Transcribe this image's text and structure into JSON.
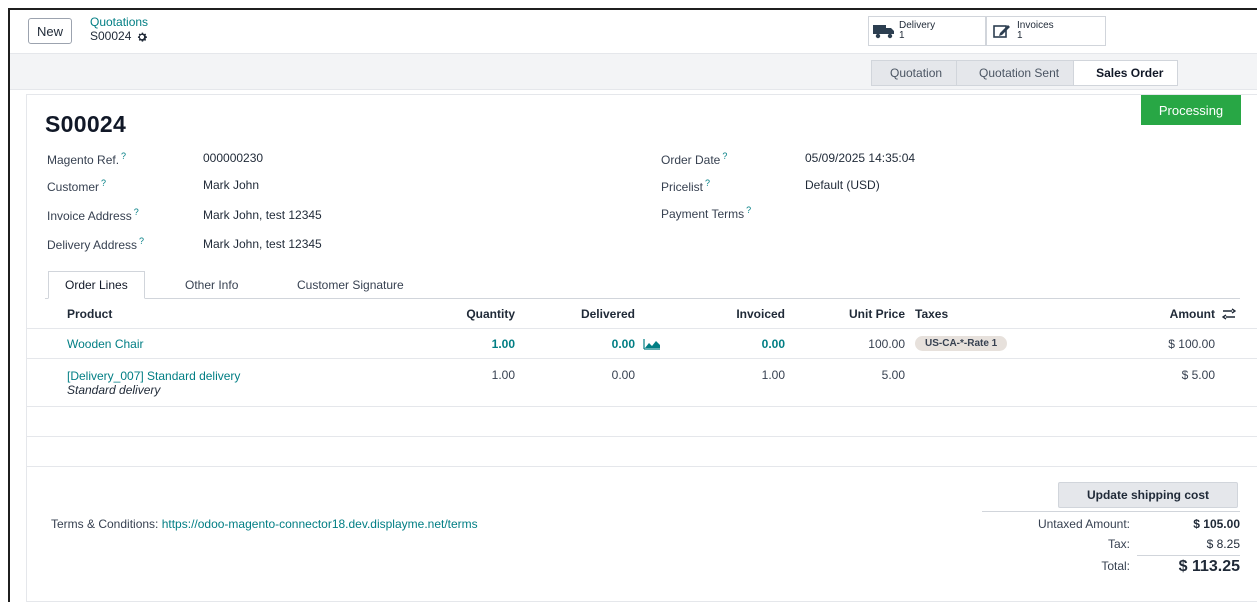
{
  "control_panel": {
    "new_label": "New",
    "breadcrumb_parent": "Quotations",
    "breadcrumb_current": "S00024",
    "smart_buttons": {
      "delivery": {
        "label": "Delivery",
        "count": "1",
        "icon": "truck-icon"
      },
      "invoices": {
        "label": "Invoices",
        "count": "1",
        "icon": "pencil-square-icon"
      }
    }
  },
  "statusbar": {
    "stages": [
      "Quotation",
      "Quotation Sent",
      "Sales Order"
    ],
    "active": "Sales Order"
  },
  "sheet": {
    "ribbon": "Processing",
    "ribbon_color": "#28a745",
    "title": "S00024",
    "fields_left": [
      {
        "label": "Magento Ref.",
        "value": "000000230"
      },
      {
        "label": "Customer",
        "value": "Mark John"
      },
      {
        "label": "Invoice Address",
        "value": "Mark John, test 12345"
      },
      {
        "label": "Delivery Address",
        "value": "Mark John, test 12345"
      }
    ],
    "fields_right": [
      {
        "label": "Order Date",
        "value": "05/09/2025 14:35:04"
      },
      {
        "label": "Pricelist",
        "value": "Default (USD)"
      },
      {
        "label": "Payment Terms",
        "value": ""
      }
    ],
    "help_marker": "?"
  },
  "tabs": [
    "Order Lines",
    "Other Info",
    "Customer Signature"
  ],
  "order_lines": {
    "headers": {
      "product": "Product",
      "quantity": "Quantity",
      "delivered": "Delivered",
      "invoiced": "Invoiced",
      "unit_price": "Unit Price",
      "taxes": "Taxes",
      "amount": "Amount"
    },
    "rows": [
      {
        "product": "Wooden Chair",
        "note": "",
        "quantity": "1.00",
        "delivered": "0.00",
        "invoiced": "0.00",
        "unit_price": "100.00",
        "tax": "US-CA-*-Rate 1",
        "amount": "$ 100.00"
      },
      {
        "product": "[Delivery_007] Standard delivery",
        "note": "Standard delivery",
        "quantity": "1.00",
        "delivered": "0.00",
        "invoiced": "1.00",
        "unit_price": "5.00",
        "tax": "",
        "amount": "$ 5.00"
      }
    ]
  },
  "footer": {
    "update_shipping_label": "Update shipping cost",
    "terms_label": "Terms & Conditions:",
    "terms_link": "https://odoo-magento-connector18.dev.displayme.net/terms",
    "totals": {
      "untaxed_label": "Untaxed Amount:",
      "untaxed_value": "$ 105.00",
      "tax_label": "Tax:",
      "tax_value": "$ 8.25",
      "total_label": "Total:",
      "total_value": "$ 113.25"
    }
  },
  "colors": {
    "accent": "#017e84",
    "status_green": "#28a745"
  }
}
